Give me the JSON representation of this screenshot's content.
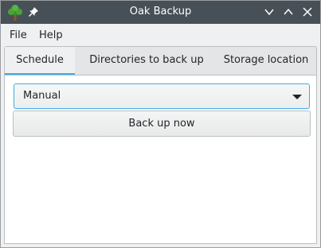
{
  "window": {
    "title": "Oak Backup"
  },
  "menu": {
    "file": "File",
    "help": "Help"
  },
  "tabs": [
    {
      "label": "Schedule",
      "selected": true
    },
    {
      "label": "Directories to back up",
      "selected": false
    },
    {
      "label": "Storage location",
      "selected": false
    }
  ],
  "schedule": {
    "frequency_value": "Manual",
    "backup_button": "Back up now"
  },
  "colors": {
    "titlebar": "#475057",
    "accent": "#3daee9",
    "window_bg": "#eff0f1"
  },
  "icons": {
    "app": "oak-tree-icon",
    "pin": "pin-icon",
    "minimize": "chevron-down-icon",
    "maximize": "chevron-up-icon",
    "close": "close-icon",
    "dropdown": "triangle-down-icon"
  }
}
